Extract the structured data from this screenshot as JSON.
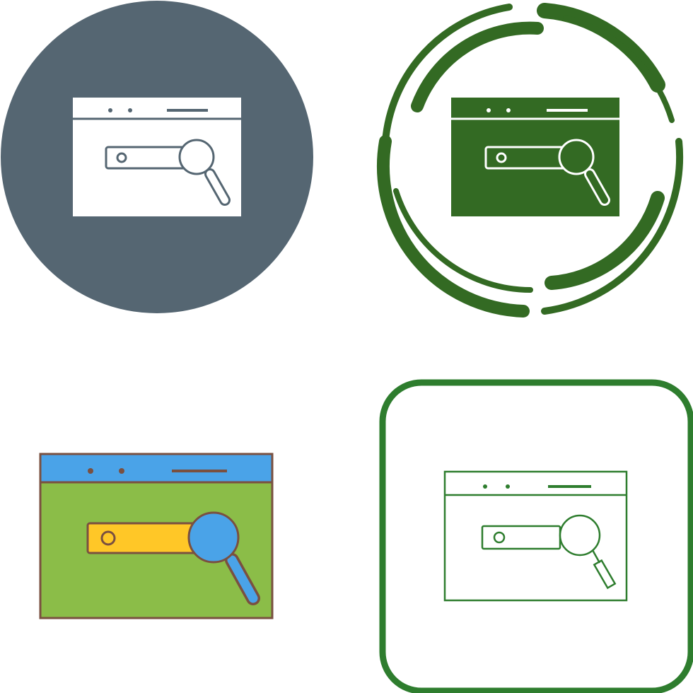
{
  "icon_set": {
    "subject": "search-browser-icon",
    "variants": [
      {
        "style": "glyph-circle",
        "background": "#556672",
        "foreground": "#ffffff"
      },
      {
        "style": "glyph-swirl-ring",
        "ring": "#336a23",
        "foreground": "#336a23",
        "detail": "#ffffff"
      },
      {
        "style": "flat-color",
        "header": "#4aa3e8",
        "body": "#8bbd48",
        "search_bar": "#ffc727",
        "lens": "#4aa3e8",
        "outline": "#7a5040"
      },
      {
        "style": "line-rounded-square",
        "stroke": "#2e7d2e",
        "background": "#ffffff"
      }
    ]
  }
}
